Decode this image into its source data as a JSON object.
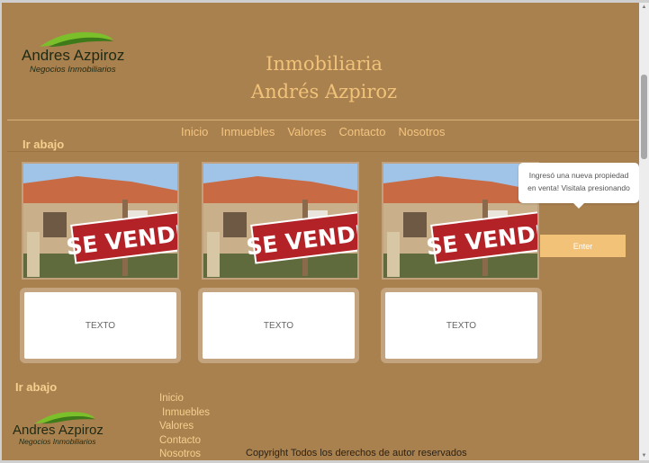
{
  "header": {
    "logo_name": "Andres Azpiroz",
    "logo_tagline": "Negocios Inmobiliarios",
    "brand_line1": "Inmobiliaria",
    "brand_line2": "Andrés Azpiroz"
  },
  "nav": [
    "Inicio",
    "Inmuebles",
    "Valores",
    "Contacto",
    "Nosotros"
  ],
  "ir_abajo_top": "Ir abajo",
  "listings": [
    {
      "sign": "SE VENDE",
      "caption": "TEXTO"
    },
    {
      "sign": "SE VENDE",
      "caption": "TEXTO"
    },
    {
      "sign": "SE VENDE",
      "caption": "TEXTO"
    }
  ],
  "notification": {
    "text": "Ingresó una nueva propiedad en venta! Visitala presionando",
    "button": "Enter"
  },
  "footer": {
    "ir_abajo": "Ir abajo",
    "logo_name": "Andres Azpiroz",
    "logo_tagline": "Negocios Inmobiliarios",
    "links": [
      "Inicio",
      "Inmuebles",
      "Valores",
      "Contacto",
      "Nosotros"
    ],
    "copyright": "Copyright Todos los derechos de autor reservados"
  },
  "scrollbar": {
    "up_icon": "chevron-up-icon",
    "down_icon": "chevron-down-icon"
  }
}
